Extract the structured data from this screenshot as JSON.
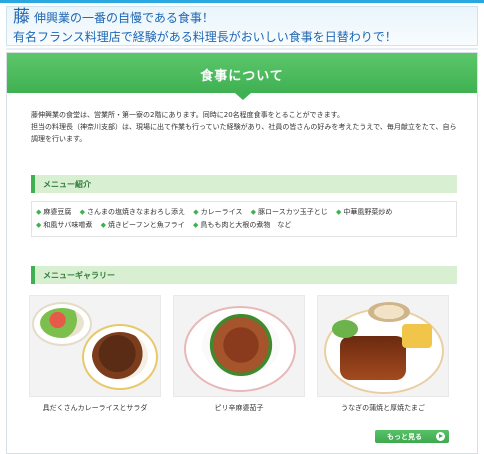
{
  "header": {
    "big_char": "藤",
    "line1": "伸興業の一番の自慢である食事！",
    "line2": "有名フランス料理店で経験がある料理長がおいしい食事を日替わりで！"
  },
  "page_title": "食事について",
  "intro": {
    "line1": "藤伸興業の食堂は、営業所・第一寮の2階にあります。同時に20名程度食事をとることができます。",
    "line2": "担当の料理長（神奈川支部）は、現場に出て作業も行っていた経験があり、社員の皆さんの好みを考えたうえで、毎月献立をたて、自ら調理を行います。"
  },
  "menu_section": {
    "heading": "メニュー紹介",
    "items": [
      "麻婆豆腐",
      "さんまの塩焼きな​まおろし添え",
      "カレーライス",
      "豚ロースカツ玉子とじ",
      "中華風野菜炒め",
      "和風サバ味噌煮",
      "焼きビーフンと魚フライ",
      "鳥もも肉と大根の煮物　など"
    ]
  },
  "gallery_section": {
    "heading": "メニューギャラリー",
    "captions": [
      "具だくさんカレーライスとサラダ",
      "ピリ辛麻婆茄子",
      "うなぎの蒲焼と厚焼たまご"
    ]
  },
  "more_button": "もっと見る",
  "colors": {
    "accent_green": "#3fb152",
    "header_blue": "#1e67b3",
    "top_bar": "#29a7e1"
  }
}
